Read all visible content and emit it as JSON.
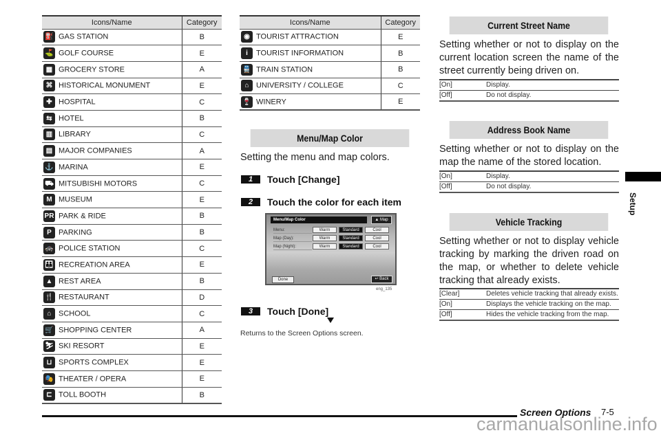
{
  "icon_table": {
    "headers": {
      "name": "Icons/Name",
      "category": "Category"
    },
    "left_rows": [
      {
        "icon": "gas-pump-icon",
        "glyph": "⛽",
        "name": "GAS STATION",
        "category": "B"
      },
      {
        "icon": "golf-flag-icon",
        "glyph": "⛳",
        "name": "GOLF COURSE",
        "category": "E"
      },
      {
        "icon": "grocery-basket-icon",
        "glyph": "▦",
        "name": "GROCERY STORE",
        "category": "A"
      },
      {
        "icon": "monument-icon",
        "glyph": "⌘",
        "name": "HISTORICAL MONUMENT",
        "category": "E"
      },
      {
        "icon": "hospital-cross-icon",
        "glyph": "✚",
        "name": "HOSPITAL",
        "category": "C"
      },
      {
        "icon": "hotel-bed-icon",
        "glyph": "⇆",
        "name": "HOTEL",
        "category": "B"
      },
      {
        "icon": "library-book-icon",
        "glyph": "▥",
        "name": "LIBRARY",
        "category": "C"
      },
      {
        "icon": "office-building-icon",
        "glyph": "▤",
        "name": "MAJOR COMPANIES",
        "category": "A"
      },
      {
        "icon": "anchor-icon",
        "glyph": "⚓",
        "name": "MARINA",
        "category": "E"
      },
      {
        "icon": "mitsubishi-logo-icon",
        "glyph": "⛟",
        "name": "MITSUBISHI MOTORS",
        "category": "C"
      },
      {
        "icon": "museum-icon",
        "glyph": "M",
        "name": "MUSEUM",
        "category": "E"
      },
      {
        "icon": "park-ride-icon",
        "glyph": "PR",
        "name": "PARK & RIDE",
        "category": "B"
      },
      {
        "icon": "parking-icon",
        "glyph": "P",
        "name": "PARKING",
        "category": "B"
      },
      {
        "icon": "police-car-icon",
        "glyph": "🚓",
        "name": "POLICE STATION",
        "category": "C"
      },
      {
        "icon": "recreation-people-icon",
        "glyph": "👪",
        "name": "RECREATION AREA",
        "category": "E"
      },
      {
        "icon": "rest-area-tree-icon",
        "glyph": "▲",
        "name": "REST AREA",
        "category": "B"
      },
      {
        "icon": "fork-knife-icon",
        "glyph": "🍴",
        "name": "RESTAURANT",
        "category": "D"
      },
      {
        "icon": "school-roof-icon",
        "glyph": "⌂",
        "name": "SCHOOL",
        "category": "C"
      },
      {
        "icon": "shopping-cart-icon",
        "glyph": "🛒",
        "name": "SHOPPING CENTER",
        "category": "A"
      },
      {
        "icon": "skier-icon",
        "glyph": "⛷",
        "name": "SKI RESORT",
        "category": "E"
      },
      {
        "icon": "stadium-icon",
        "glyph": "⊔",
        "name": "SPORTS COMPLEX",
        "category": "E"
      },
      {
        "icon": "theater-masks-icon",
        "glyph": "🎭",
        "name": "THEATER / OPERA",
        "category": "E"
      },
      {
        "icon": "toll-booth-icon",
        "glyph": "⊏",
        "name": "TOLL BOOTH",
        "category": "B"
      }
    ],
    "right_rows": [
      {
        "icon": "tourist-eye-icon",
        "glyph": "◉",
        "name": "TOURIST ATTRACTION",
        "category": "E"
      },
      {
        "icon": "info-icon",
        "glyph": "i",
        "name": "TOURIST INFORMATION",
        "category": "B"
      },
      {
        "icon": "train-icon",
        "glyph": "🚆",
        "name": "TRAIN STATION",
        "category": "B"
      },
      {
        "icon": "university-roof-icon",
        "glyph": "⌂",
        "name": "UNIVERSITY / COLLEGE",
        "category": "C"
      },
      {
        "icon": "wine-bottle-icon",
        "glyph": "🍷",
        "name": "WINERY",
        "category": "E"
      }
    ]
  },
  "menu_map_color": {
    "heading": "Menu/Map Color",
    "description": "Setting the menu and map colors.",
    "steps": [
      {
        "num": "1",
        "text": "Touch [Change]"
      },
      {
        "num": "2",
        "text": "Touch the color for each item"
      },
      {
        "num": "3",
        "text": "Touch [Done]"
      }
    ],
    "result_text": "Returns to the Screen Options screen.",
    "screenshot": {
      "title": "Menu/Map Color",
      "map_button": "▲ Map",
      "rows": [
        {
          "label": "Menu:",
          "options": [
            "Warm",
            "Standard",
            "Cool"
          ],
          "selected": "Standard"
        },
        {
          "label": "Map (Day):",
          "options": [
            "Warm",
            "Standard",
            "Cool"
          ],
          "selected": "Standard"
        },
        {
          "label": "Map (Night):",
          "options": [
            "Warm",
            "Standard",
            "Cool"
          ],
          "selected": "Standard"
        }
      ],
      "done_button": "Done",
      "back_button": "↩ Back",
      "caption": "eng_135"
    }
  },
  "current_street_name": {
    "heading": "Current Street Name",
    "description": "Setting whether or not to display on the current location screen the name of the street currently being driven on.",
    "options": [
      {
        "key": "[On]",
        "value": "Display."
      },
      {
        "key": "[Off]",
        "value": "Do not display."
      }
    ]
  },
  "address_book_name": {
    "heading": "Address Book Name",
    "description": "Setting whether or not to display on the map the name of the stored location.",
    "options": [
      {
        "key": "[On]",
        "value": "Display."
      },
      {
        "key": "[Off]",
        "value": "Do not display."
      }
    ]
  },
  "vehicle_tracking": {
    "heading": "Vehicle Tracking",
    "description": "Setting whether or not to display vehicle tracking by marking the driven road on the map, or whether to delete vehicle tracking that already exists.",
    "options": [
      {
        "key": "[Clear]",
        "value": "Deletes vehicle tracking that already exists."
      },
      {
        "key": "[On]",
        "value": "Displays the vehicle tracking on the map."
      },
      {
        "key": "[Off]",
        "value": "Hides the vehicle tracking from the map."
      }
    ]
  },
  "footer": {
    "section_title": "Screen Options",
    "page_number": "7-5",
    "watermark": "carmanualsonline.info"
  },
  "side_tab": {
    "label": "Setup"
  }
}
